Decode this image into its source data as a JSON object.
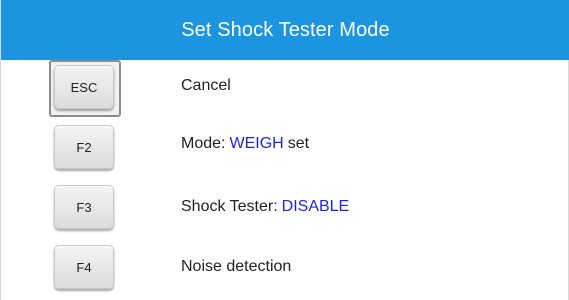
{
  "dialog": {
    "title": "Set Shock Tester Mode"
  },
  "options": {
    "esc": {
      "key": "ESC",
      "label": "Cancel"
    },
    "f2": {
      "key": "F2",
      "label": "Mode:",
      "value": "WEIGH",
      "suffix": "set"
    },
    "f3": {
      "key": "F3",
      "label": "Shock Tester:",
      "value": "DISABLE"
    },
    "f4": {
      "key": "F4",
      "label": "Noise detection"
    }
  },
  "colors": {
    "header": "#1b95e0",
    "value": "#1f25e6"
  }
}
